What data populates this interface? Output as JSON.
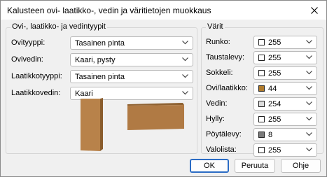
{
  "window": {
    "title": "Kalusteen ovi- laatikko-, vedin ja väritietojen muokkaus"
  },
  "left_group": {
    "title": "Ovi-, laatikko- ja vedintyypit",
    "rows": [
      {
        "label": "Ovityyppi:",
        "value": "Tasainen pinta"
      },
      {
        "label": "Ovivedin:",
        "value": "Kaari, pysty"
      },
      {
        "label": "Laatikkotyyppi:",
        "value": "Tasainen pinta"
      },
      {
        "label": "Laatikkovedin:",
        "value": "Kaari"
      }
    ]
  },
  "right_group": {
    "title": "Värit",
    "rows": [
      {
        "label": "Runko:",
        "value": "255",
        "swatch": "#ffffff"
      },
      {
        "label": "Taustalevy:",
        "value": "255",
        "swatch": "#ffffff"
      },
      {
        "label": "Sokkeli:",
        "value": "255",
        "swatch": "#ffffff"
      },
      {
        "label": "Ovi/laatikko:",
        "value": "44",
        "swatch": "#b07a2a"
      },
      {
        "label": "Vedin:",
        "value": "254",
        "swatch": "#dcdcdc"
      },
      {
        "label": "Hylly:",
        "value": "255",
        "swatch": "#ffffff"
      },
      {
        "label": "Pöytälevy:",
        "value": "8",
        "swatch": "#7a7a7a"
      },
      {
        "label": "Valolista:",
        "value": "255",
        "swatch": "#ffffff"
      }
    ]
  },
  "buttons": {
    "ok": "OK",
    "cancel": "Peruuta",
    "help": "Ohje"
  },
  "colors": {
    "door_face": "#b8824a",
    "door_edge": "#8a5c2c",
    "drawer_face": "#b07a44",
    "drawer_top": "#8f6232"
  },
  "icons": {
    "close": "close-icon",
    "dropdown": "chevron-down-icon"
  }
}
